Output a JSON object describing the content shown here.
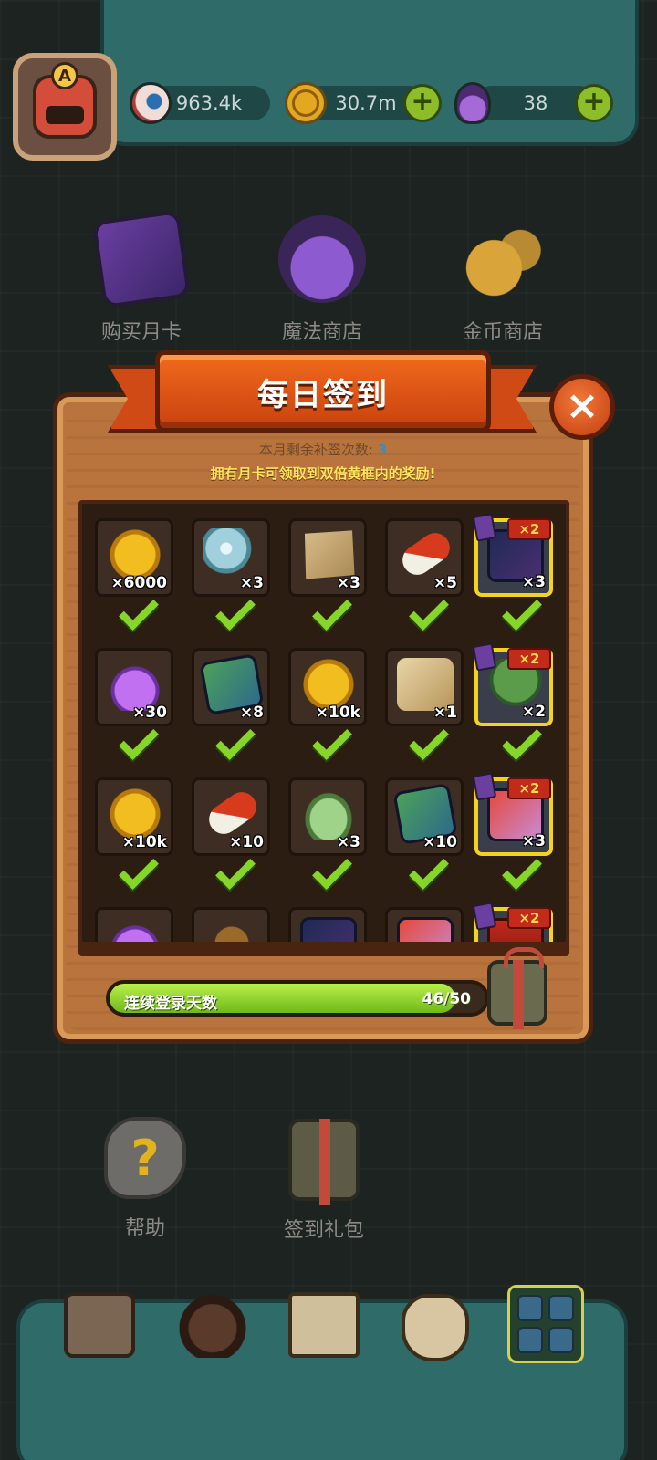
{
  "resources": {
    "eyeballs": "963.4k",
    "gold": "30.7m",
    "potions": "38",
    "plus_label": "+"
  },
  "avatar": {
    "letter": "A"
  },
  "menu": {
    "items": [
      {
        "label": "购买月卡",
        "icon": "card-pack-icon"
      },
      {
        "label": "魔法商店",
        "icon": "magic-shop-icon"
      },
      {
        "label": "金币商店",
        "icon": "gold-shop-icon"
      },
      {
        "label": "帮助",
        "icon": "help-icon"
      },
      {
        "label": "签到礼包",
        "icon": "signin-gift-icon"
      }
    ]
  },
  "dialog": {
    "title": "每日签到",
    "close_label": "×",
    "retro_text": "本月剩余补签次数:",
    "retro_count": "3",
    "hint": "拥有月卡可领取到双倍黄框内的奖励!",
    "double_tag": "×2",
    "rows": [
      [
        {
          "icon": "gold-coin-icon",
          "qty": "×6000",
          "claimed": true
        },
        {
          "icon": "pearl-icon",
          "qty": "×3",
          "claimed": true
        },
        {
          "icon": "map-icon",
          "qty": "×3",
          "claimed": true
        },
        {
          "icon": "capsule-icon",
          "qty": "×5",
          "claimed": true
        },
        {
          "icon": "monster-card-icon",
          "qty": "×3",
          "claimed": true,
          "double": true
        }
      ],
      [
        {
          "icon": "potion-icon",
          "qty": "×30",
          "claimed": true
        },
        {
          "icon": "ticket-icon",
          "qty": "×8",
          "claimed": true
        },
        {
          "icon": "gold-coin-icon",
          "qty": "×10k",
          "claimed": true
        },
        {
          "icon": "scroll-icon",
          "qty": "×1",
          "claimed": true
        },
        {
          "icon": "monster-card-icon",
          "qty": "×2",
          "claimed": true,
          "double": true
        }
      ],
      [
        {
          "icon": "gold-coin-icon",
          "qty": "×10k",
          "claimed": true
        },
        {
          "icon": "capsule-icon",
          "qty": "×10",
          "claimed": true
        },
        {
          "icon": "egg-icon",
          "qty": "×3",
          "claimed": true
        },
        {
          "icon": "ticket-icon",
          "qty": "×10",
          "claimed": true
        },
        {
          "icon": "cape-icon",
          "qty": "×3",
          "claimed": true,
          "double": true
        }
      ],
      [
        {
          "icon": "potion-icon",
          "qty": "",
          "claimed": false
        },
        {
          "icon": "root-icon",
          "qty": "",
          "claimed": false
        },
        {
          "icon": "monster-card-icon",
          "qty": "",
          "claimed": false
        },
        {
          "icon": "cape-icon",
          "qty": "",
          "claimed": false
        },
        {
          "icon": "chest-icon",
          "qty": "",
          "claimed": false,
          "double": true
        }
      ]
    ],
    "streak": {
      "label": "连续登录天数",
      "current": 46,
      "total": 50,
      "text": "46/50"
    }
  },
  "bottom_nav": [
    {
      "icon": "shop-building-icon"
    },
    {
      "icon": "monster-lair-icon"
    },
    {
      "icon": "book-icon"
    },
    {
      "icon": "money-bag-icon"
    },
    {
      "icon": "more-grid-icon"
    }
  ],
  "colors": {
    "accent_orange": "#d04a16",
    "check_green": "#86d62a",
    "double_border": "#f5d31c",
    "teal_bar": "#2f6b69",
    "retro_count_blue": "#2b8ed0"
  }
}
